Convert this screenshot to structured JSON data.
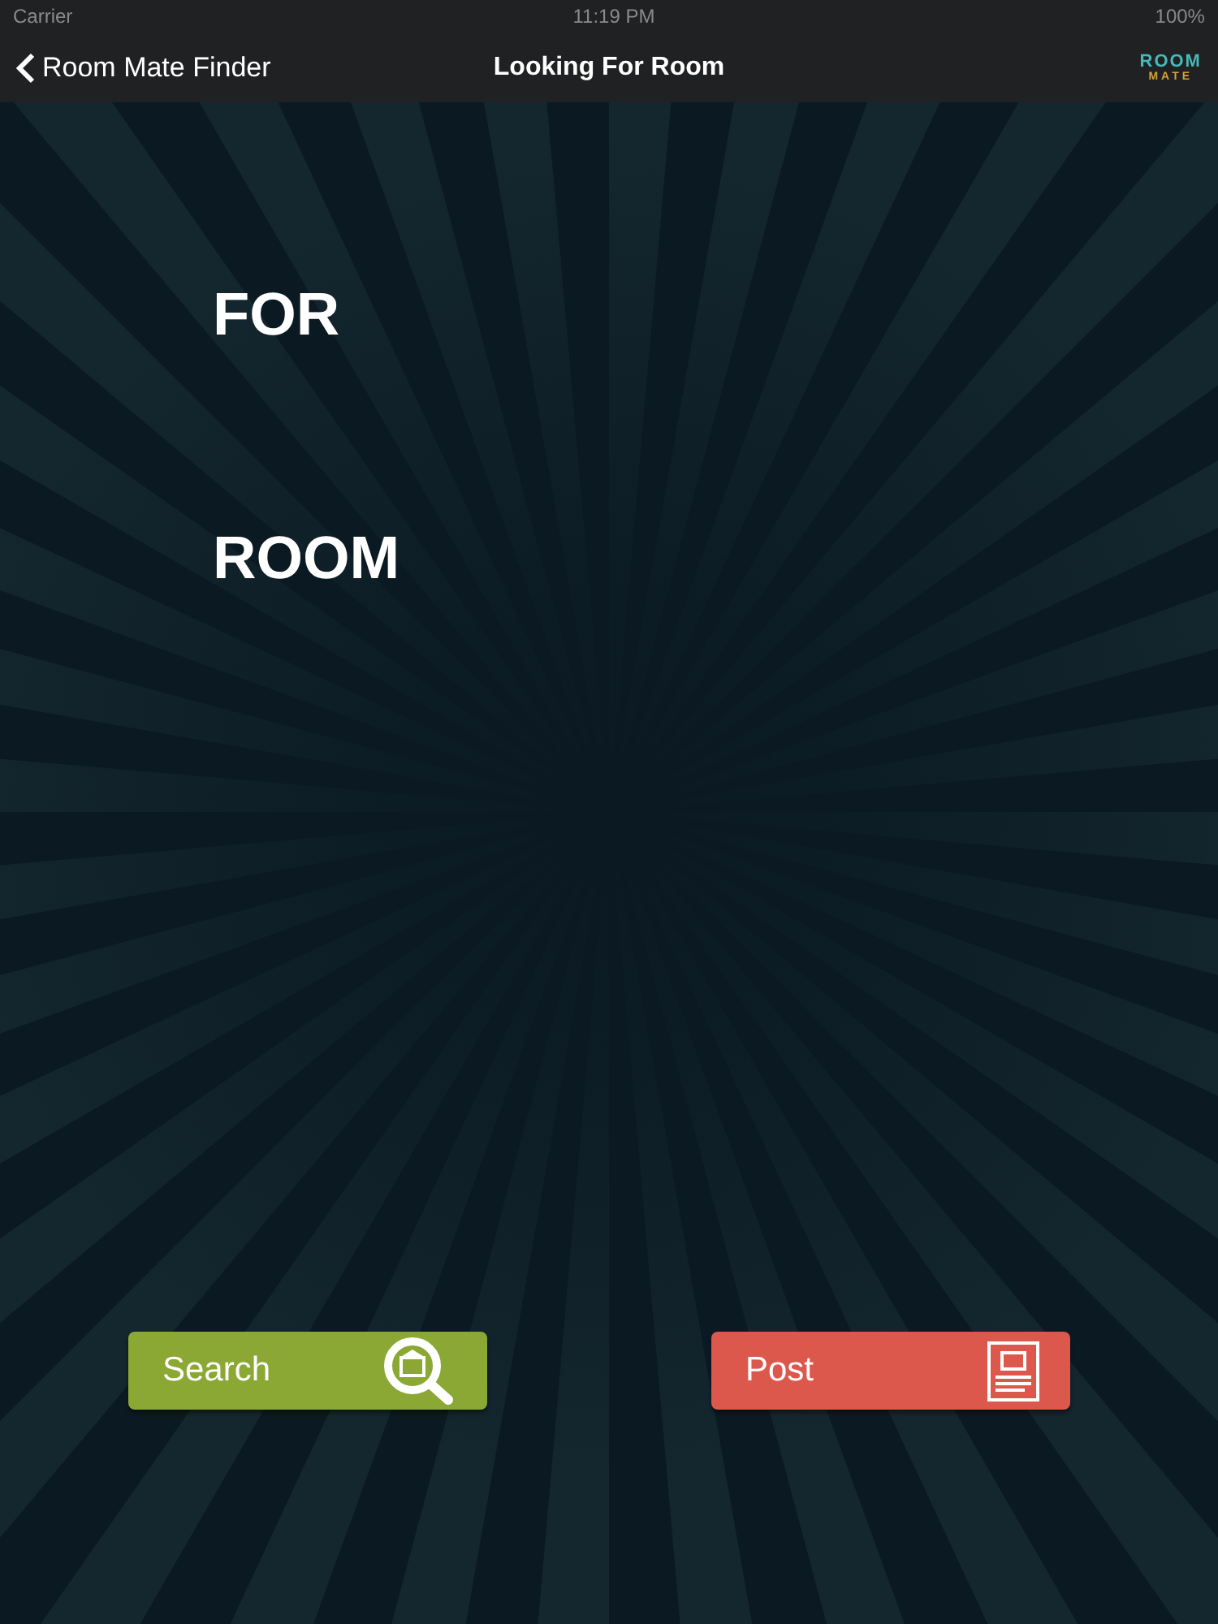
{
  "status_bar": {
    "carrier": "Carrier",
    "time": "11:19 PM",
    "battery": "100%"
  },
  "nav_bar": {
    "back_label": "Room Mate Finder",
    "title": "Looking For Room",
    "logo": {
      "top": "ROOM",
      "bottom": "MATE"
    }
  },
  "headings": [
    "FOR",
    "ROOM"
  ],
  "buttons": [
    {
      "kind": "search",
      "label": "Search"
    },
    {
      "kind": "post",
      "label": "Post"
    }
  ]
}
